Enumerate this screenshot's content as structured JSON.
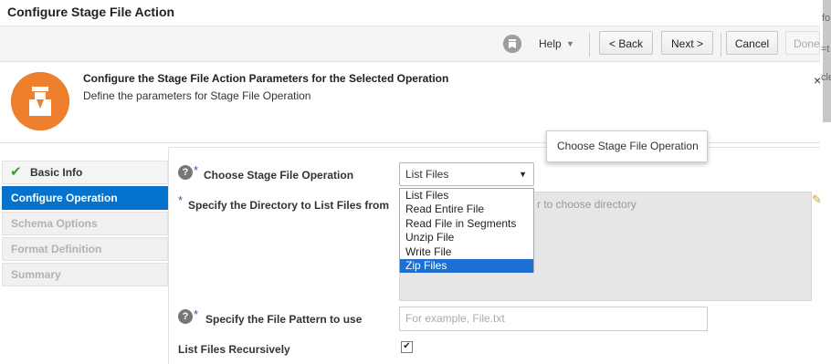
{
  "window": {
    "title": "Configure Stage File Action"
  },
  "toolbar": {
    "help_icon": "wizard-help-icon",
    "help_label": "Help",
    "help_caret": "▼",
    "back_label": "< Back",
    "next_label": "Next >",
    "cancel_label": "Cancel",
    "done_label": "Done"
  },
  "header": {
    "title": "Configure the Stage File Action Parameters for the Selected Operation",
    "subtitle": "Define the parameters for Stage File Operation",
    "icon": "stage-file-icon",
    "icon_color": "#ee7f2d"
  },
  "nav": {
    "items": [
      {
        "label": "Basic Info",
        "state": "done"
      },
      {
        "label": "Configure Operation",
        "state": "active"
      },
      {
        "label": "Schema Options",
        "state": "disabled"
      },
      {
        "label": "Format Definition",
        "state": "disabled"
      },
      {
        "label": "Summary",
        "state": "disabled"
      }
    ],
    "active_color": "#0572ce"
  },
  "form": {
    "operation_label": "Choose Stage File Operation",
    "operation_value": "List Files",
    "operation_options": [
      "List Files",
      "Read Entire File",
      "Read File in Segments",
      "Unzip File",
      "Write File",
      "Zip Files"
    ],
    "operation_highlighted": "Zip Files",
    "directory_label": "Specify the Directory to List Files from",
    "directory_placeholder": "r to choose directory",
    "pattern_label": "Specify the File Pattern to use",
    "pattern_placeholder": "For example, File.txt",
    "recursive_label": "List Files Recursively",
    "recursive_checked": true,
    "required_marker": "*",
    "help_glyph": "?"
  },
  "tooltip": {
    "text": "Choose Stage File Operation"
  },
  "edge": {
    "text1": "fo",
    "text2": "=t",
    "text3": "cle",
    "close": "×"
  }
}
